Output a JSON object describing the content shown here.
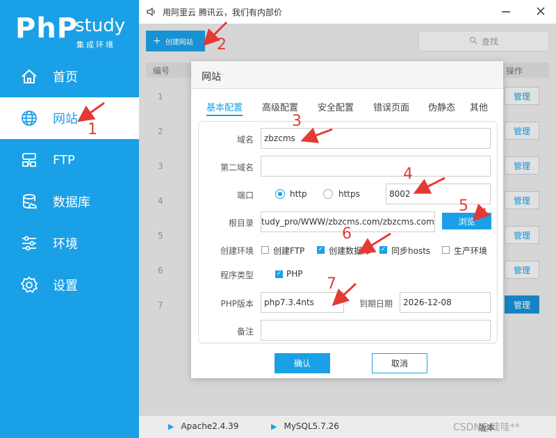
{
  "logo": {
    "php": "PhP",
    "study": "study",
    "sub": "集成环境"
  },
  "sidebar": {
    "items": [
      {
        "label": "首页",
        "icon": "home-icon"
      },
      {
        "label": "网站",
        "icon": "globe-icon"
      },
      {
        "label": "FTP",
        "icon": "ftp-icon"
      },
      {
        "label": "数据库",
        "icon": "database-icon"
      },
      {
        "label": "环境",
        "icon": "sliders-icon"
      },
      {
        "label": "设置",
        "icon": "gear-icon"
      }
    ]
  },
  "topbar": {
    "notice": "用阿里云 腾讯云，我们有内部价"
  },
  "toolbar": {
    "create_site": "创建网站",
    "search_placeholder": "查找"
  },
  "table": {
    "header_num": "编号",
    "header_op": "操作",
    "rows": [
      "1",
      "2",
      "3",
      "4",
      "5",
      "6",
      "7"
    ],
    "manage_label": "管理"
  },
  "status_bar": {
    "services": [
      "Apache2.4.39",
      "MySQL5.7.26"
    ],
    "version_label": "版本"
  },
  "dialog": {
    "title": "网站",
    "tabs": [
      "基本配置",
      "高级配置",
      "安全配置",
      "错误页面",
      "伪静态",
      "其他"
    ],
    "active_tab": "基本配置",
    "fields": {
      "domain_label": "域名",
      "domain_value": "zbzcms",
      "domain2_label": "第二域名",
      "domain2_value": "",
      "port_label": "端口",
      "http_label": "http",
      "https_label": "https",
      "port_value": "8002",
      "root_label": "根目录",
      "root_value": "tudy_pro/WWW/zbzcms.com/zbzcms.com",
      "browse_label": "浏览",
      "env_label": "创建环境",
      "env_options": [
        {
          "label": "创建FTP",
          "checked": false
        },
        {
          "label": "创建数据库",
          "checked": true
        },
        {
          "label": "同步hosts",
          "checked": true
        },
        {
          "label": "生产环境",
          "checked": false
        }
      ],
      "type_label": "程序类型",
      "type_option": "PHP",
      "php_version_label": "PHP版本",
      "php_version_value": "php7.3.4nts",
      "expire_label": "到期日期",
      "expire_value": "2026-12-08",
      "note_label": "备注",
      "note_value": ""
    },
    "confirm_label": "确认",
    "cancel_label": "取消"
  },
  "annotations": [
    "1",
    "2",
    "3",
    "4",
    "5",
    "6",
    "7"
  ],
  "watermark": "CSDN@哇哇**",
  "colors": {
    "brand": "#1aa0e6",
    "annotation": "#e53935"
  }
}
